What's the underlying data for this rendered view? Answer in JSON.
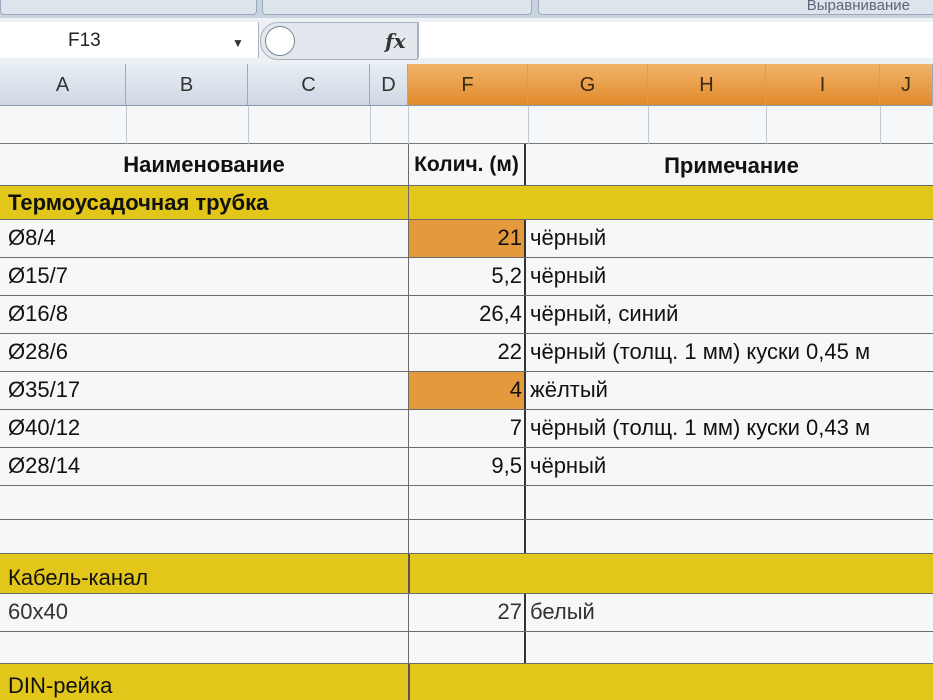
{
  "ribbon": {
    "group_label": "Выравнивание"
  },
  "formula_bar": {
    "name_box": "F13",
    "fx_label": "fx",
    "formula": ""
  },
  "columns": [
    "A",
    "B",
    "C",
    "D",
    "F",
    "G",
    "H",
    "I",
    "J"
  ],
  "table": {
    "header": {
      "name": "Наименование",
      "qty": "Колич. (м)",
      "note": "Примечание"
    },
    "section1": "Термоусадочная трубка",
    "rows": [
      {
        "name": "Ø8/4",
        "qty": "21",
        "note": "чёрный"
      },
      {
        "name": "Ø15/7",
        "qty": "5,2",
        "note": "чёрный"
      },
      {
        "name": "Ø16/8",
        "qty": "26,4",
        "note": "чёрный, синий"
      },
      {
        "name": "Ø28/6",
        "qty": "22",
        "note": "чёрный (толщ. 1 мм) куски 0,45 м"
      },
      {
        "name": "Ø35/17",
        "qty": "4",
        "note": "жёлтый"
      },
      {
        "name": "Ø40/12",
        "qty": "7",
        "note": "чёрный (толщ. 1 мм) куски 0,43 м"
      },
      {
        "name": "Ø28/14",
        "qty": "9,5",
        "note": "чёрный"
      }
    ],
    "section2": "Кабель-канал",
    "cable_row": {
      "name": "60x40",
      "qty": "27",
      "note": "белый"
    },
    "section3": "DIN-рейка"
  },
  "colors": {
    "section_fill": "#e3c61a",
    "highlight_fill": "#e49a3c",
    "selected_header": "#e08a2c"
  }
}
